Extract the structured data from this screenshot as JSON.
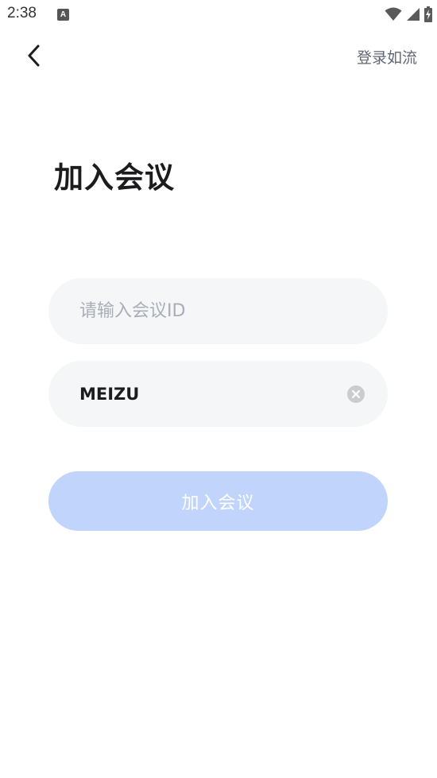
{
  "status_bar": {
    "time": "2:38",
    "notification_icon": "A",
    "icons": [
      "wifi-icon",
      "signal-icon",
      "battery-charging-icon"
    ]
  },
  "header": {
    "back_icon": "chevron-left-icon",
    "login_link": "登录如流"
  },
  "page_title": "加入会议",
  "form": {
    "meeting_id": {
      "value": "",
      "placeholder": "请输入会议ID"
    },
    "display_name": {
      "value": "MEIZU",
      "placeholder": ""
    },
    "clear_icon": "clear-icon",
    "join_button": "加入会议"
  },
  "colors": {
    "button_disabled_bg": "#c1d5fc",
    "field_bg": "#f5f6f8",
    "title": "#1c1c1f",
    "link": "#5f6674"
  }
}
